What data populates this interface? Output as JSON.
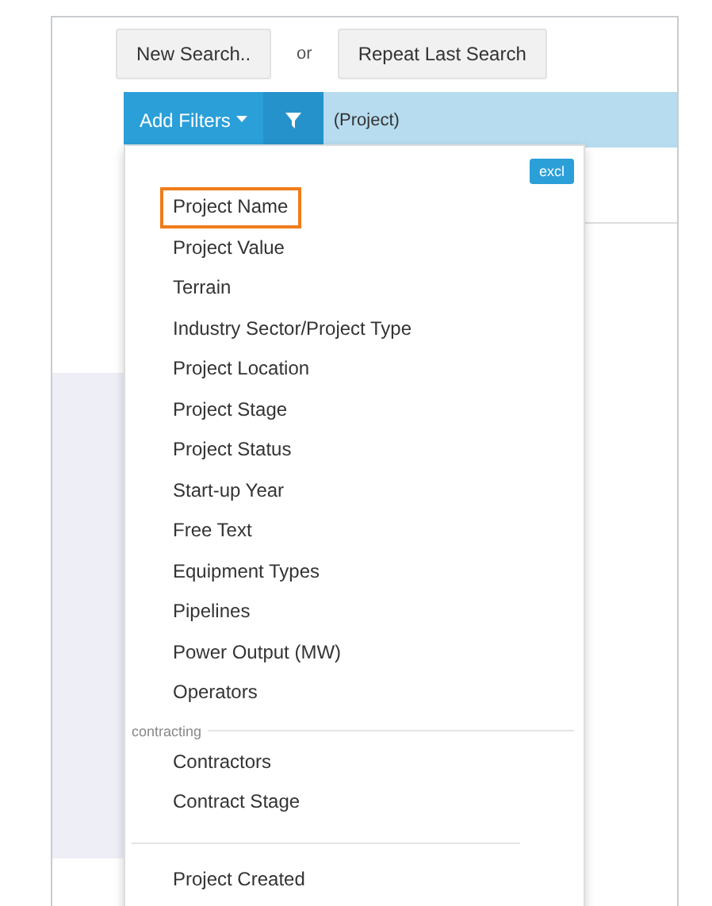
{
  "search_buttons": {
    "new_search": "New Search..",
    "separator": "or",
    "repeat_search": "Repeat Last Search"
  },
  "filter_bar": {
    "add_filters": "Add Filters",
    "scope": "(Project)"
  },
  "dropdown": {
    "exclude_button": "excl",
    "sections": [
      {
        "items": [
          {
            "label": "Project Name",
            "selected": true
          },
          {
            "label": "Project Value",
            "selected": false
          },
          {
            "label": "Terrain",
            "selected": false
          },
          {
            "label": "Industry Sector/Project Type",
            "selected": false
          },
          {
            "label": "Project Location",
            "selected": false
          },
          {
            "label": "Project Stage",
            "selected": false
          },
          {
            "label": "Project Status",
            "selected": false
          },
          {
            "label": "Start-up Year",
            "selected": false
          },
          {
            "label": "Free Text",
            "selected": false
          },
          {
            "label": "Equipment Types",
            "selected": false
          },
          {
            "label": "Pipelines",
            "selected": false
          },
          {
            "label": "Power Output (MW)",
            "selected": false
          },
          {
            "label": "Operators",
            "selected": false
          }
        ]
      },
      {
        "heading": "contracting",
        "items": [
          {
            "label": "Contractors",
            "selected": false
          },
          {
            "label": "Contract Stage",
            "selected": false
          }
        ]
      },
      {
        "items": [
          {
            "label": "Project Created",
            "selected": false
          }
        ]
      }
    ]
  }
}
